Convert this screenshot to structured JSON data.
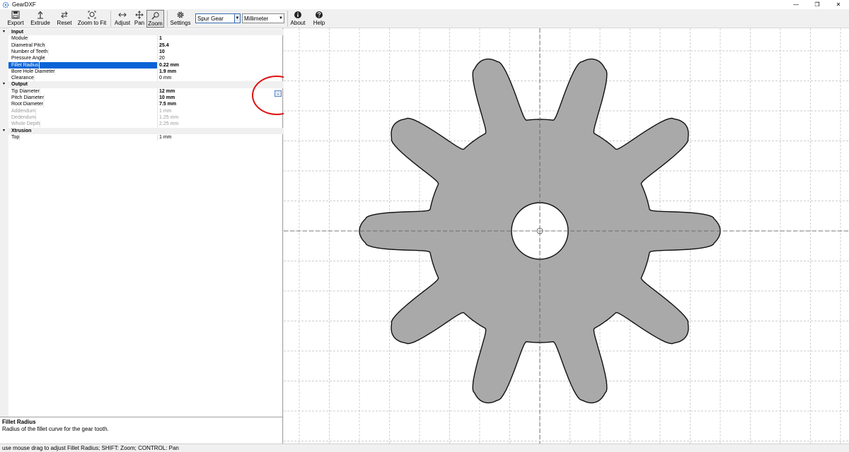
{
  "window": {
    "title": "GearDXF",
    "minimize": "—",
    "maximize": "❐",
    "close": "✕"
  },
  "toolbar": {
    "export": "Export",
    "extrude": "Extrude",
    "reset": "Reset",
    "zoom_to_fit": "Zoom to Fit",
    "adjust": "Adjust",
    "pan": "Pan",
    "zoom": "Zoom",
    "settings": "Settings",
    "gear_type": "Spur Gear",
    "unit": "Millimeter",
    "about": "About",
    "help": "Help"
  },
  "properties": {
    "input": {
      "category": "Input",
      "module_label": "Module",
      "module_value": "1",
      "dp_label": "Diametral Pitch",
      "dp_value": "25.4",
      "teeth_label": "Number of Teeth",
      "teeth_value": "10",
      "pa_label": "Pressure Angle",
      "pa_value": "20",
      "fillet_label": "Fillet Radius",
      "fillet_value": "0.22 mm",
      "bore_label": "Bore Hole Diameter",
      "bore_value": "1.9 mm",
      "clearance_label": "Clearance",
      "clearance_value": "0 mm"
    },
    "output": {
      "category": "Output",
      "tip_label": "Tip Diameter",
      "tip_value": "12 mm",
      "pitch_label": "Pitch Diameter",
      "pitch_value": "10 mm",
      "root_label": "Root Diameter",
      "root_value": "7.5 mm",
      "addendum_label": "Addendum",
      "addendum_value": "1 mm",
      "dedendum_label": "Dedendum",
      "dedendum_value": "1.25 mm",
      "depth_label": "Whole Depth",
      "depth_value": "2.25 mm"
    },
    "xtrusion": {
      "category": "Xtrusion",
      "top_label": "Top",
      "top_value": "1 mm"
    }
  },
  "help": {
    "title": "Fillet Radius",
    "description": "Radius of the fillet curve for the gear tooth."
  },
  "status": "use mouse drag to adjust Fillet Radius; SHIFT: Zoom; CONTROL: Pan",
  "gear": {
    "teeth": 10
  },
  "colors": {
    "gear_fill": "#a9a9a9",
    "selection": "#0a64d6",
    "annotation": "#e01010"
  }
}
